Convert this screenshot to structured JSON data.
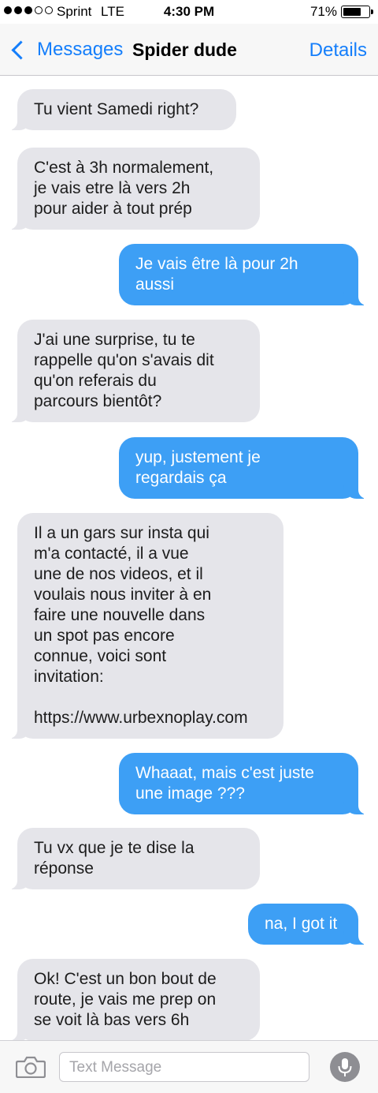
{
  "status_bar": {
    "carrier": "Sprint",
    "network": "LTE",
    "time": "4:30 PM",
    "battery": "71%",
    "battery_level": 0.71,
    "signal_bars_filled": 3,
    "signal_bars_total": 5
  },
  "nav": {
    "back_label": "Messages",
    "title": "Spider dude",
    "details_label": "Details"
  },
  "messages": [
    {
      "direction": "in",
      "text": "Tu vient Samedi right?"
    },
    {
      "direction": "in",
      "text": "C'est à 3h normalement,\nje vais etre là vers 2h\npour aider à tout prép"
    },
    {
      "direction": "out",
      "text": "Je vais être là pour 2h\naussi"
    },
    {
      "direction": "in",
      "text": "J'ai une surprise, tu te\nrappelle qu'on s'avais dit\nqu'on referais du\nparcours bientôt?"
    },
    {
      "direction": "out",
      "text": "yup, justement je\nregardais ça"
    },
    {
      "direction": "in",
      "text": "Il a un gars sur insta qui\nm'a contacté, il a vue\nune de nos videos, et il\nvoulais nous inviter à en\nfaire une nouvelle dans\nun spot pas encore\nconnue, voici sont\ninvitation:\n\nhttps://www.urbexnoplay.com"
    },
    {
      "direction": "out",
      "text": "Whaaat, mais c'est juste\nune image ???"
    },
    {
      "direction": "in",
      "text": "Tu vx que je te dise la\nréponse"
    },
    {
      "direction": "out",
      "text": "na, I got it"
    },
    {
      "direction": "in",
      "text": "Ok! C'est un bon bout de\nroute, je vais me prep on\nse voit là bas vers 6h"
    }
  ],
  "input": {
    "placeholder": "Text Message"
  },
  "icons": {
    "back": "chevron-left-icon",
    "camera": "camera-icon",
    "mic": "microphone-icon"
  },
  "colors": {
    "accent": "#147efb",
    "outgoing_bubble": "#3d9ff5",
    "incoming_bubble": "#e5e5ea"
  }
}
